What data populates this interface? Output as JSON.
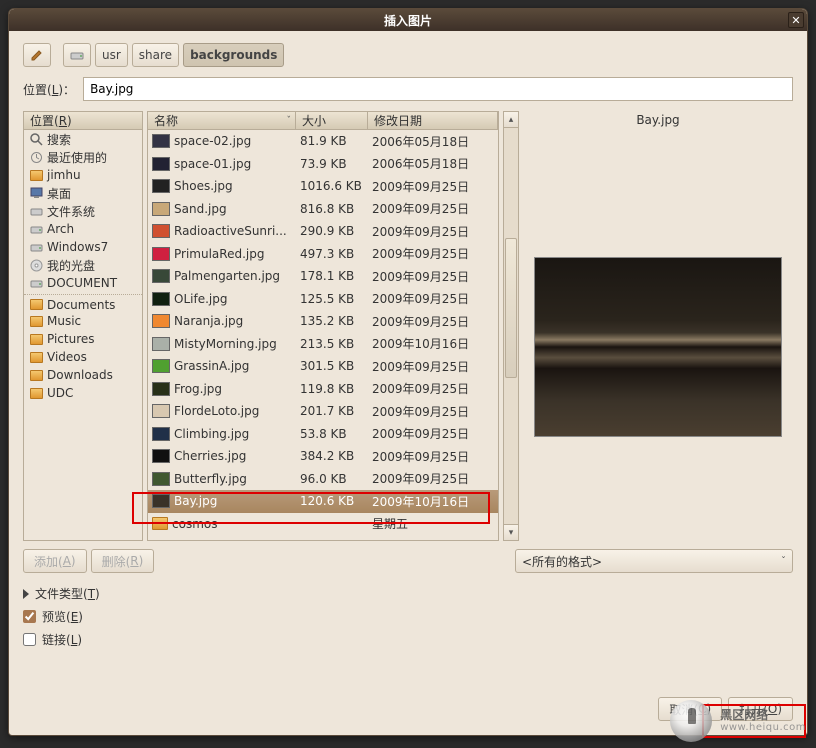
{
  "window": {
    "title": "插入图片"
  },
  "toolbar": {
    "path": [
      "usr",
      "share",
      "backgrounds"
    ]
  },
  "location": {
    "label": "位置(L)：",
    "value": "Bay.jpg"
  },
  "places": {
    "header": "位置(R)",
    "items": [
      {
        "icon": "search",
        "label": "搜索"
      },
      {
        "icon": "recent",
        "label": "最近使用的"
      },
      {
        "icon": "home",
        "label": "jimhu"
      },
      {
        "icon": "desktop",
        "label": "桌面"
      },
      {
        "icon": "fs",
        "label": "文件系统"
      },
      {
        "icon": "disk",
        "label": "Arch"
      },
      {
        "icon": "disk",
        "label": "Windows7"
      },
      {
        "icon": "cd",
        "label": "我的光盘"
      },
      {
        "icon": "disk",
        "label": "DOCUMENT"
      },
      {
        "icon": "folder",
        "label": "Documents",
        "sep": true
      },
      {
        "icon": "folder",
        "label": "Music"
      },
      {
        "icon": "folder",
        "label": "Pictures"
      },
      {
        "icon": "folder",
        "label": "Videos"
      },
      {
        "icon": "folder",
        "label": "Downloads"
      },
      {
        "icon": "folder",
        "label": "UDC"
      }
    ]
  },
  "columns": {
    "name": "名称",
    "size": "大小",
    "modified": "修改日期"
  },
  "files": [
    {
      "name": "space-02.jpg",
      "size": "81.9 KB",
      "date": "2006年05月18日",
      "thumb": "#334"
    },
    {
      "name": "space-01.jpg",
      "size": "73.9 KB",
      "date": "2006年05月18日",
      "thumb": "#223"
    },
    {
      "name": "Shoes.jpg",
      "size": "1016.6 KB",
      "date": "2009年09月25日",
      "thumb": "#222"
    },
    {
      "name": "Sand.jpg",
      "size": "816.8 KB",
      "date": "2009年09月25日",
      "thumb": "#c8a878"
    },
    {
      "name": "RadioactiveSunri...",
      "size": "290.9 KB",
      "date": "2009年09月25日",
      "thumb": "#d05030"
    },
    {
      "name": "PrimulaRed.jpg",
      "size": "497.3 KB",
      "date": "2009年09月25日",
      "thumb": "#d02040"
    },
    {
      "name": "Palmengarten.jpg",
      "size": "178.1 KB",
      "date": "2009年09月25日",
      "thumb": "#384838"
    },
    {
      "name": "OLife.jpg",
      "size": "125.5 KB",
      "date": "2009年09月25日",
      "thumb": "#102010"
    },
    {
      "name": "Naranja.jpg",
      "size": "135.2 KB",
      "date": "2009年09月25日",
      "thumb": "#f08830"
    },
    {
      "name": "MistyMorning.jpg",
      "size": "213.5 KB",
      "date": "2009年10月16日",
      "thumb": "#aab0a8"
    },
    {
      "name": "GrassinA.jpg",
      "size": "301.5 KB",
      "date": "2009年09月25日",
      "thumb": "#50a030"
    },
    {
      "name": "Frog.jpg",
      "size": "119.8 KB",
      "date": "2009年09月25日",
      "thumb": "#283018"
    },
    {
      "name": "FlordeLoto.jpg",
      "size": "201.7 KB",
      "date": "2009年09月25日",
      "thumb": "#d8c8b0"
    },
    {
      "name": "Climbing.jpg",
      "size": "53.8 KB",
      "date": "2009年09月25日",
      "thumb": "#203048"
    },
    {
      "name": "Cherries.jpg",
      "size": "384.2 KB",
      "date": "2009年09月25日",
      "thumb": "#101010"
    },
    {
      "name": "Butterfly.jpg",
      "size": "96.0 KB",
      "date": "2009年09月25日",
      "thumb": "#405830"
    },
    {
      "name": "Bay.jpg",
      "size": "120.6 KB",
      "date": "2009年10月16日",
      "thumb": "#3a3228",
      "selected": true
    },
    {
      "name": "cosmos",
      "size": "",
      "date": "星期五",
      "folder": true
    }
  ],
  "preview": {
    "filename": "Bay.jpg"
  },
  "buttons": {
    "add": "添加(A)",
    "remove": "删除(R)",
    "cancel": "取消(C)",
    "open": "打开(O)"
  },
  "format": {
    "selected": "<所有的格式>"
  },
  "options": {
    "filetype": "文件类型(T)",
    "preview": "预览(E)",
    "link": "链接(L)",
    "preview_checked": true,
    "link_checked": false
  },
  "watermark": {
    "title": "黑区网络",
    "sub": "www.heiqu.com"
  }
}
